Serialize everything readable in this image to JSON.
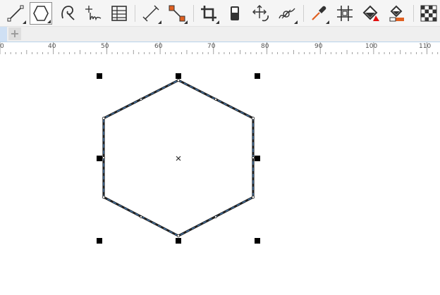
{
  "toolbar": {
    "tools": [
      {
        "name": "line-tool",
        "icon": "line-icon"
      },
      {
        "name": "polygon-tool",
        "icon": "hexagon-icon",
        "selected": true
      },
      {
        "name": "spiral-tool",
        "icon": "spiral-icon"
      },
      {
        "name": "freehand-tool",
        "icon": "freehand-icon"
      },
      {
        "name": "table-tool",
        "icon": "table-icon"
      },
      {
        "name": "dimension-tool",
        "icon": "dimension-icon"
      },
      {
        "name": "connector-tool",
        "icon": "connector-icon"
      },
      {
        "name": "crop-tool",
        "icon": "crop-icon"
      },
      {
        "name": "eraser-tool",
        "icon": "eraser-icon"
      },
      {
        "name": "transform-tool",
        "icon": "move-rotate-icon"
      },
      {
        "name": "smear-tool",
        "icon": "smear-icon"
      },
      {
        "name": "eyedropper-tool",
        "icon": "eyedropper-icon"
      },
      {
        "name": "contour-tool",
        "icon": "contour-icon"
      },
      {
        "name": "fill-tool",
        "icon": "fill-icon"
      },
      {
        "name": "smart-fill-tool",
        "icon": "smart-fill-icon"
      },
      {
        "name": "transparency-tool",
        "icon": "checkerboard-icon"
      }
    ]
  },
  "tabs": {
    "add_label": "+"
  },
  "ruler": {
    "labels": [
      "0",
      "40",
      "50",
      "60",
      "70",
      "80",
      "90",
      "100",
      "110"
    ]
  },
  "colors": {
    "selection_handle": "#000000",
    "shape_outline": "#222222",
    "outline_highlight": "#4a90d9",
    "icon_accent": "#e06020",
    "fill_red": "#e01010"
  }
}
